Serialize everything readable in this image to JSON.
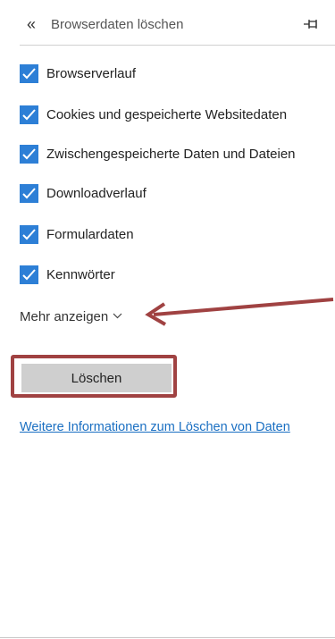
{
  "header": {
    "back_icon": "double-chevron-left-icon",
    "back_glyph": "«",
    "title": "Browserdaten löschen",
    "pin_icon": "pin-icon"
  },
  "options": [
    {
      "label": "Browserverlauf",
      "checked": true
    },
    {
      "label": "Cookies und gespeicherte Websitedaten",
      "checked": true
    },
    {
      "label": "Zwischengespeicherte Daten und Dateien",
      "checked": true
    },
    {
      "label": "Downloadverlauf",
      "checked": true
    },
    {
      "label": "Formulardaten",
      "checked": true
    },
    {
      "label": "Kennwörter",
      "checked": true
    }
  ],
  "show_more": {
    "label": "Mehr anzeigen",
    "icon": "chevron-down-icon"
  },
  "actions": {
    "delete_label": "Löschen"
  },
  "info_link": "Weitere Informationen zum Löschen von Daten",
  "colors": {
    "checkbox": "#2d7fd6",
    "annotation": "#a04242",
    "link": "#1a6fc2",
    "button": "#cfcfcf"
  }
}
